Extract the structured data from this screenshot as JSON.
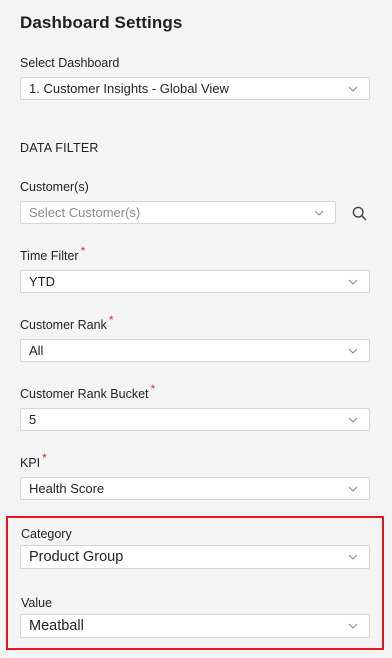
{
  "page": {
    "title": "Dashboard Settings"
  },
  "dashboard": {
    "label": "Select Dashboard",
    "value": "1. Customer Insights - Global View"
  },
  "data_filter": {
    "heading": "DATA FILTER",
    "customers": {
      "label": "Customer(s)",
      "placeholder": "Select Customer(s)"
    },
    "time_filter": {
      "label": "Time Filter",
      "required": "*",
      "value": "YTD"
    },
    "customer_rank": {
      "label": "Customer Rank",
      "required": "*",
      "value": "All"
    },
    "customer_rank_bucket": {
      "label": "Customer Rank Bucket",
      "required": "*",
      "value": "5"
    },
    "kpi": {
      "label": "KPI",
      "required": "*",
      "value": "Health Score"
    },
    "category": {
      "label": "Category",
      "value": "Product Group"
    },
    "value_field": {
      "label": "Value",
      "value": "Meatball"
    }
  },
  "colors": {
    "required_asterisk": "#d9332e",
    "highlight_border": "#e8151f"
  },
  "icons": {
    "dropdown": "chevron-down-icon",
    "search": "search-icon"
  }
}
